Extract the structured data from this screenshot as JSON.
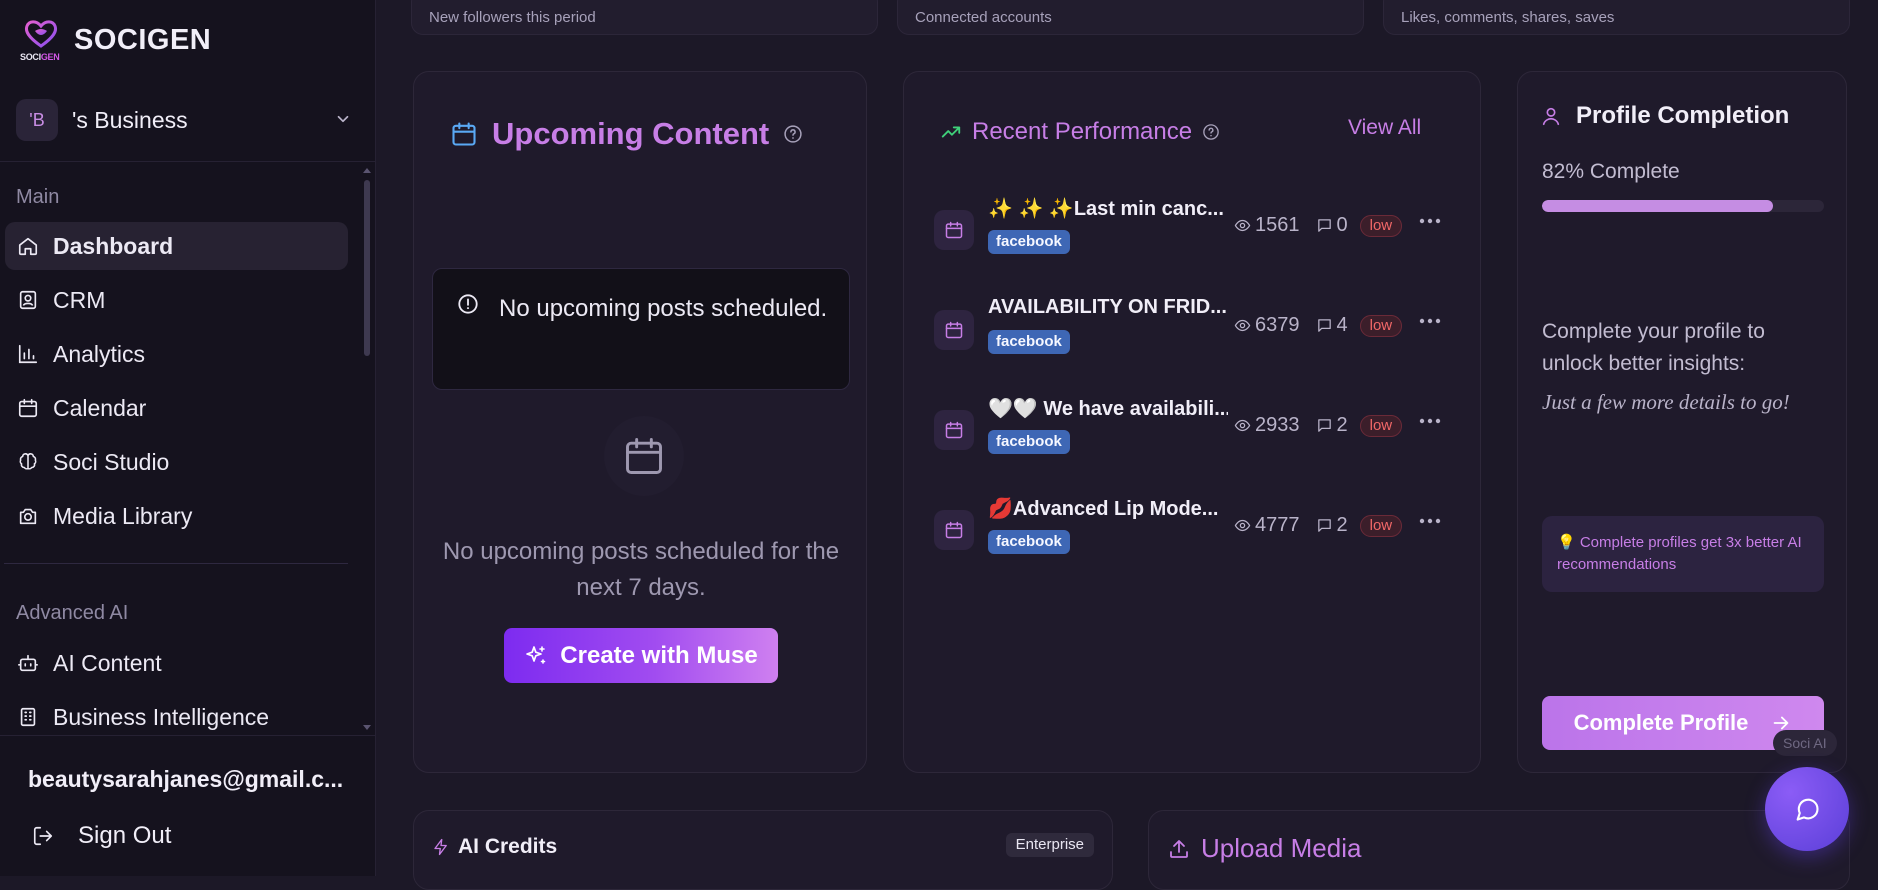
{
  "brand": {
    "name": "SOCIGEN",
    "logo_text_a": "SOCI",
    "logo_text_b": "GEN"
  },
  "business": {
    "avatar": "'B",
    "name": "'s Business"
  },
  "sidebar": {
    "main_label": "Main",
    "items": [
      {
        "label": "Dashboard",
        "icon": "home-icon",
        "active": true
      },
      {
        "label": "CRM",
        "icon": "contact-card-icon"
      },
      {
        "label": "Analytics",
        "icon": "bar-chart-icon"
      },
      {
        "label": "Calendar",
        "icon": "calendar-icon"
      },
      {
        "label": "Soci Studio",
        "icon": "brain-icon"
      },
      {
        "label": "Media Library",
        "icon": "camera-icon"
      }
    ],
    "advanced_label": "Advanced AI",
    "advanced_items": [
      {
        "label": "AI Content",
        "icon": "bot-icon"
      },
      {
        "label": "Business Intelligence",
        "icon": "building-icon"
      }
    ],
    "user_email": "beautysarahjanes@gmail.c...",
    "sign_out": "Sign Out"
  },
  "stats_strip": [
    "New followers this period",
    "Connected accounts",
    "Likes, comments, shares, saves"
  ],
  "upcoming": {
    "title": "Upcoming Content",
    "alert": "No upcoming posts scheduled.",
    "empty_text": "No upcoming posts scheduled for the next 7 days.",
    "button": "Create with Muse"
  },
  "performance": {
    "title": "Recent Performance",
    "view_all": "View All",
    "posts": [
      {
        "title": "✨ ✨ ✨Last min canc...",
        "platform": "facebook",
        "views": "1561",
        "comments": "0",
        "level": "low"
      },
      {
        "title": "AVAILABILITY ON FRID...",
        "platform": "facebook",
        "views": "6379",
        "comments": "4",
        "level": "low"
      },
      {
        "title": "🤍🤍 We have availabili...",
        "platform": "facebook",
        "views": "2933",
        "comments": "2",
        "level": "low"
      },
      {
        "title": "💋Advanced Lip Mode...",
        "platform": "facebook",
        "views": "4777",
        "comments": "2",
        "level": "low"
      }
    ]
  },
  "profile": {
    "title": "Profile Completion",
    "percent_text": "82% Complete",
    "percent": 82,
    "message": "Complete your profile to unlock better insights:",
    "sub": "Just a few more details to go!",
    "tip": "💡 Complete profiles get 3x better AI recommendations",
    "button": "Complete Profile"
  },
  "credits": {
    "title": "AI Credits",
    "badge": "Enterprise"
  },
  "upload": {
    "title": "Upload Media"
  },
  "chat": {
    "label": "Soci AI"
  },
  "colors": {
    "accent": "#c77ee6",
    "background": "#1c1827",
    "sidebar": "#15121e"
  }
}
